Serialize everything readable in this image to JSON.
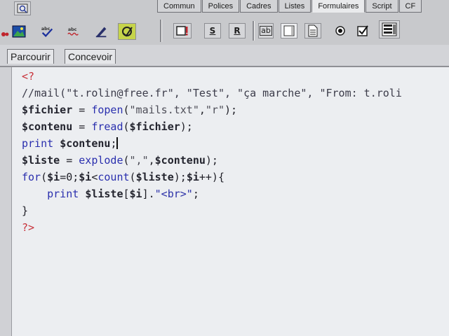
{
  "toolbar": {
    "insert_tabs": [
      "Commun",
      "Polices",
      "Cadres",
      "Listes",
      "Formulaires",
      "Script",
      "CF"
    ],
    "active_tab_index": 4,
    "buttons": {
      "s_label": "S",
      "r_label": "R",
      "ab_label": "ab"
    }
  },
  "mode_tabs": {
    "parcourir": "Parcourir",
    "concevoir": "Concevoir"
  },
  "code": {
    "lines": [
      [
        {
          "t": "<?",
          "c": "tag"
        }
      ],
      [
        {
          "t": "//mail(\"t.rolin@free.fr\", \"Test\", \"ça marche\", \"From: t.roli",
          "c": "com"
        }
      ],
      [
        {
          "t": "$fichier",
          "c": "var"
        },
        {
          "t": " = ",
          "c": "txt"
        },
        {
          "t": "fopen",
          "c": "fn"
        },
        {
          "t": "(",
          "c": "txt"
        },
        {
          "t": "\"mails.txt\"",
          "c": "str"
        },
        {
          "t": ",",
          "c": "txt"
        },
        {
          "t": "\"r\"",
          "c": "str"
        },
        {
          "t": ");",
          "c": "txt"
        }
      ],
      [
        {
          "t": "$contenu",
          "c": "var"
        },
        {
          "t": " = ",
          "c": "txt"
        },
        {
          "t": "fread",
          "c": "fn"
        },
        {
          "t": "(",
          "c": "txt"
        },
        {
          "t": "$fichier",
          "c": "var"
        },
        {
          "t": ");",
          "c": "txt"
        }
      ],
      [
        {
          "t": "print",
          "c": "kw"
        },
        {
          "t": " ",
          "c": "txt"
        },
        {
          "t": "$contenu",
          "c": "var"
        },
        {
          "t": ";",
          "c": "txt"
        }
      ],
      [
        {
          "t": "$liste",
          "c": "var"
        },
        {
          "t": " = ",
          "c": "txt"
        },
        {
          "t": "explode",
          "c": "fn"
        },
        {
          "t": "(",
          "c": "txt"
        },
        {
          "t": "\",\"",
          "c": "str"
        },
        {
          "t": ",",
          "c": "txt"
        },
        {
          "t": "$contenu",
          "c": "var"
        },
        {
          "t": ");",
          "c": "txt"
        }
      ],
      [
        {
          "t": "for",
          "c": "kw"
        },
        {
          "t": "(",
          "c": "txt"
        },
        {
          "t": "$i",
          "c": "var"
        },
        {
          "t": "=0;",
          "c": "txt"
        },
        {
          "t": "$i",
          "c": "var"
        },
        {
          "t": "<",
          "c": "txt"
        },
        {
          "t": "count",
          "c": "fn"
        },
        {
          "t": "(",
          "c": "txt"
        },
        {
          "t": "$liste",
          "c": "var"
        },
        {
          "t": ");",
          "c": "txt"
        },
        {
          "t": "$i",
          "c": "var"
        },
        {
          "t": "++){",
          "c": "txt"
        }
      ],
      [
        {
          "t": "    ",
          "c": "txt"
        },
        {
          "t": "print",
          "c": "kw"
        },
        {
          "t": " ",
          "c": "txt"
        },
        {
          "t": "$liste",
          "c": "var"
        },
        {
          "t": "[",
          "c": "txt"
        },
        {
          "t": "$i",
          "c": "var"
        },
        {
          "t": "].",
          "c": "txt"
        },
        {
          "t": "\"<br>\"",
          "c": "html"
        },
        {
          "t": ";",
          "c": "txt"
        }
      ],
      [
        {
          "t": "}",
          "c": "txt"
        }
      ],
      [
        {
          "t": "?>",
          "c": "tag"
        }
      ]
    ]
  }
}
